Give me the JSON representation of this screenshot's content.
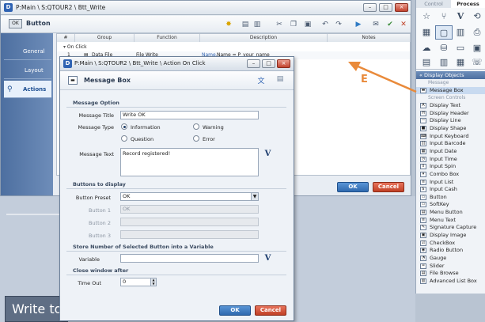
{
  "main_window": {
    "path": "P:Main \\ S:QTOUR2 \\ Btt_Write",
    "object_name": "Button",
    "object_badge": "OK",
    "nav": [
      {
        "label": "General"
      },
      {
        "label": "Layout"
      },
      {
        "label": "Actions"
      }
    ],
    "grid": {
      "columns": [
        "#",
        "Group",
        "Function",
        "Description",
        "Notes"
      ],
      "group_label": "On Click",
      "row_num": "1",
      "row_group": "Data File",
      "row_function": "File Write",
      "row_description_key": "Name.",
      "row_description": "Name = P_your_name"
    },
    "ok_label": "OK",
    "cancel_label": "Cancel"
  },
  "dialog": {
    "path": "P:Main \\ S:QTOUR2 \\ Btt_Write \\ Action On Click",
    "header_title": "Message Box",
    "sections": {
      "message_option": "Message Option",
      "buttons_to_display": "Buttons to display",
      "store_number": "Store Number of Selected Button into a Variable",
      "close_window": "Close window after"
    },
    "message_title_label": "Message Title",
    "message_title_value": "Write OK",
    "message_type_label": "Message Type",
    "message_types": [
      "Information",
      "Warning",
      "Question",
      "Error"
    ],
    "message_type_selected": "Information",
    "message_text_label": "Message Text",
    "message_text_value": "Record registered!",
    "button_preset_label": "Button Preset",
    "button_preset_value": "OK",
    "button1_label": "Button 1",
    "button1_value": "OK",
    "button2_label": "Button 2",
    "button3_label": "Button 3",
    "variable_label": "Variable",
    "timeout_label": "Time Out",
    "timeout_value": "0",
    "ok_label": "OK",
    "cancel_label": "Cancel"
  },
  "annotation": {
    "letter": "E",
    "color": "#e98a3a"
  },
  "right_panel": {
    "tabs": [
      "Control",
      "Process"
    ],
    "active_tab": "Process",
    "display_objects_label": "Display Objects",
    "category_message": "Message",
    "category_screen_controls": "Screen Controls",
    "message_items": [
      "Message Box"
    ],
    "screen_controls": [
      "Display Text",
      "Display Header",
      "Display Line",
      "Display Shape",
      "Input Keyboard",
      "Input Barcode",
      "Input Date",
      "Input Time",
      "Input Spin",
      "Combo Box",
      "Input List",
      "Input Cash",
      "Button",
      "SoftKey",
      "Menu Button",
      "Menu Text",
      "Signature Capture",
      "Display Image",
      "CheckBox",
      "Radio Button",
      "Gauge",
      "Slider",
      "File Browse",
      "Advanced List Box"
    ]
  },
  "canvas": {
    "text": "Write to"
  }
}
